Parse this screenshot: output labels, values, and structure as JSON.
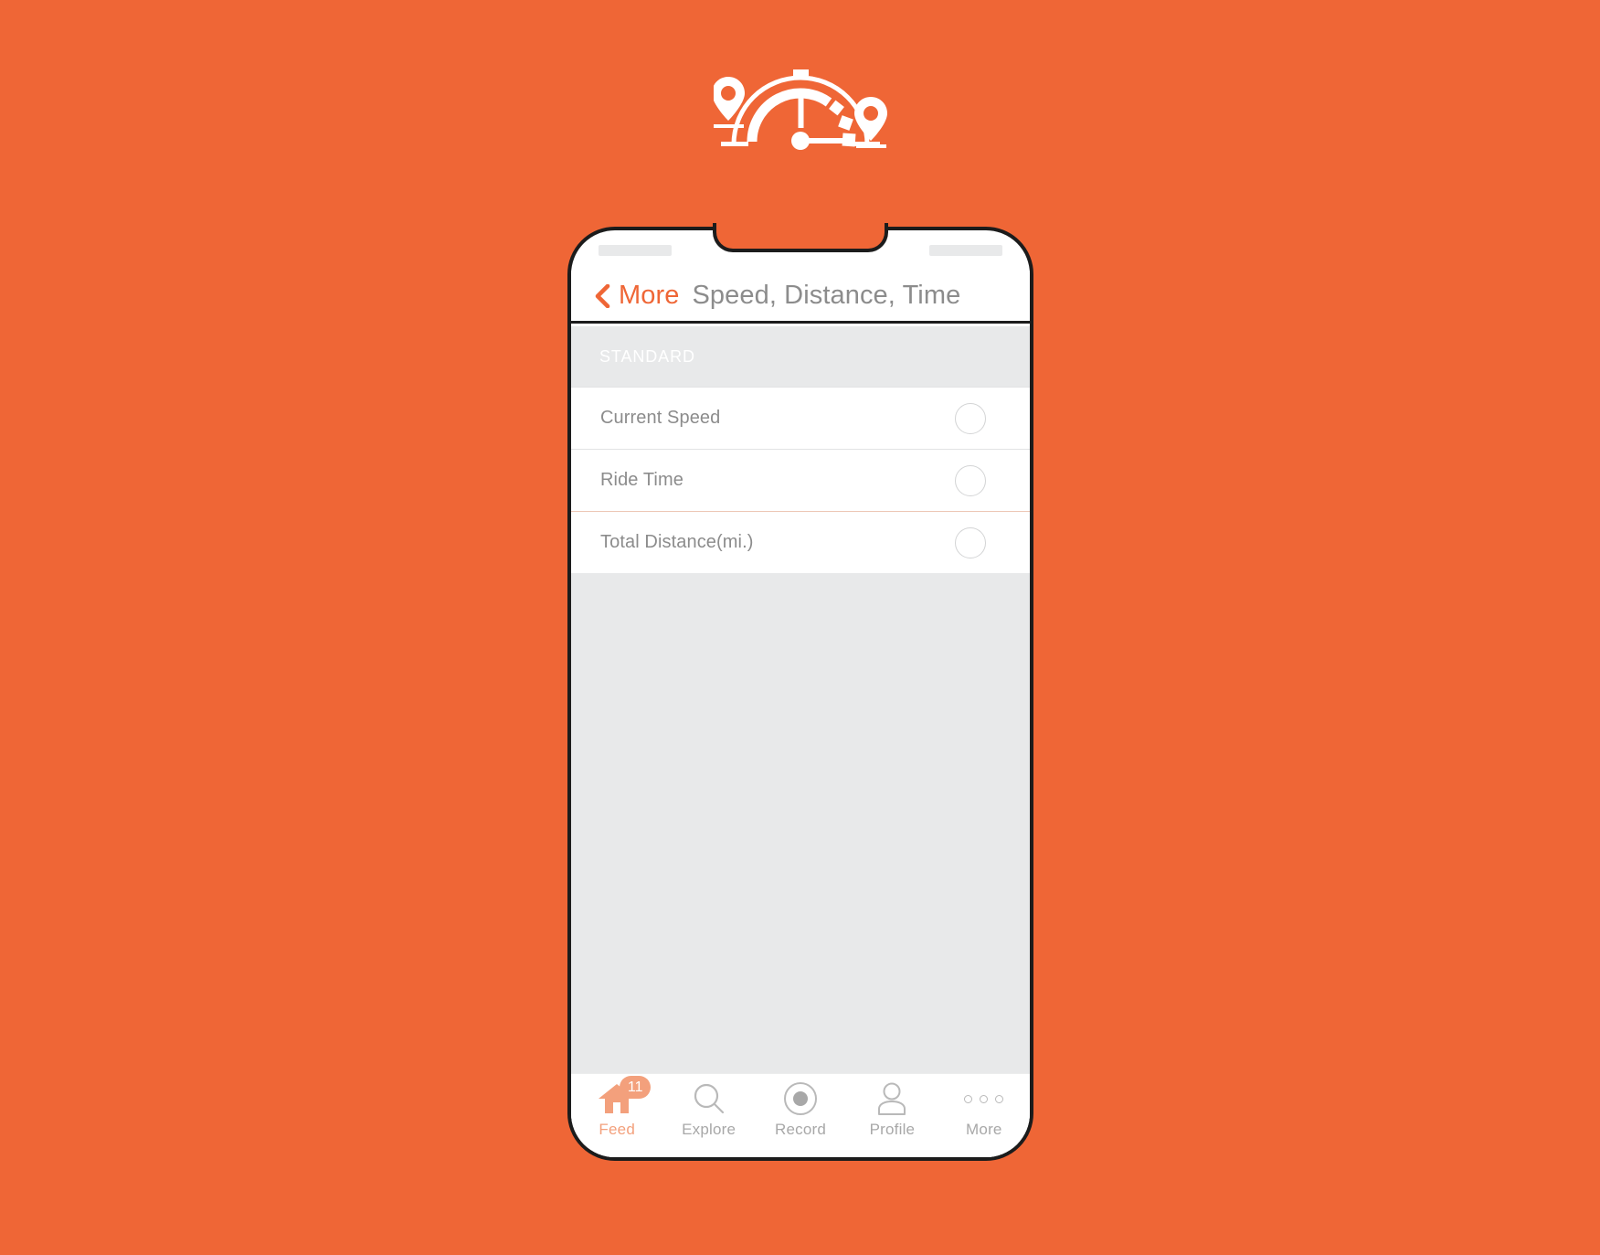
{
  "theme": {
    "background": "#ef6636",
    "accent": "#ef6636",
    "accent_soft": "#f3a07c",
    "text_muted": "#8c8c8c",
    "panel_gray": "#e8e9ea",
    "outline": "#1c1c1c"
  },
  "logo": {
    "name": "speed-distance-time-logo",
    "description": "speedometer arc with needle between two map pins",
    "color": "#ffffff"
  },
  "phone": {
    "status_bar": {
      "left_placeholder": "",
      "right_placeholder": ""
    },
    "navbar": {
      "back_icon": "chevron-left-icon",
      "back_label": "More",
      "title": "Speed, Distance, Time"
    },
    "content": {
      "section_header": "STANDARD",
      "rows": [
        {
          "label": "Current Speed",
          "toggle": "radio-circle",
          "selected": false,
          "divider": "default"
        },
        {
          "label": "Ride Time",
          "toggle": "radio-circle",
          "selected": false,
          "divider": "default"
        },
        {
          "label": "Total Distance(mi.)",
          "toggle": "radio-circle",
          "selected": false,
          "divider": "accent"
        }
      ]
    },
    "tabbar": {
      "items": [
        {
          "label": "Feed",
          "icon": "home-icon",
          "active": true,
          "badge": "11"
        },
        {
          "label": "Explore",
          "icon": "search-icon",
          "active": false,
          "badge": ""
        },
        {
          "label": "Record",
          "icon": "record-icon",
          "active": false,
          "badge": ""
        },
        {
          "label": "Profile",
          "icon": "person-icon",
          "active": false,
          "badge": ""
        },
        {
          "label": "More",
          "icon": "ellipsis-icon",
          "active": false,
          "badge": ""
        }
      ]
    }
  }
}
